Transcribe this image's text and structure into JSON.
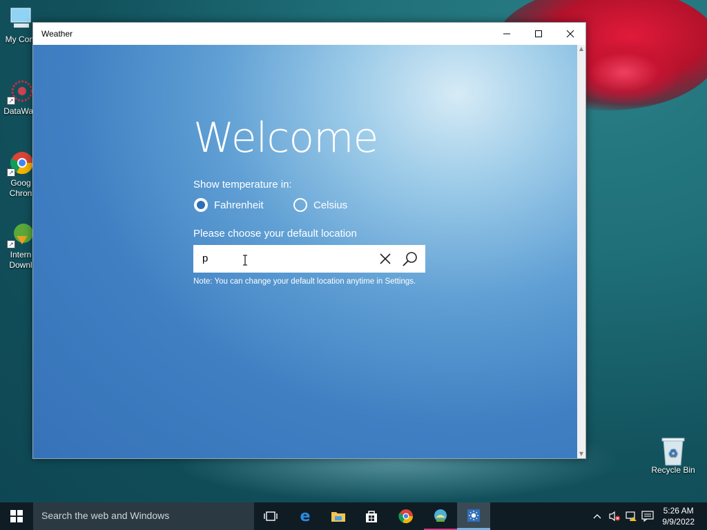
{
  "desktop": {
    "icons": [
      {
        "label": "My Com"
      },
      {
        "label": "DataWag"
      },
      {
        "label": "Goog Chron"
      },
      {
        "label": "Intern Downl"
      },
      {
        "label": "Recycle Bin"
      }
    ]
  },
  "window": {
    "title": "Weather"
  },
  "welcome": {
    "heading": "Welcome",
    "temp_label": "Show temperature in:",
    "options": [
      "Fahrenheit",
      "Celsius"
    ],
    "selected": "Fahrenheit",
    "location_label": "Please choose your default location",
    "location_value": "p",
    "note": "Note: You can change your default location anytime in Settings."
  },
  "taskbar": {
    "search_placeholder": "Search the web and Windows",
    "time": "5:26 AM",
    "date": "9/9/2022"
  },
  "colors": {
    "taskbar_bg": "#101c24",
    "radio_accent": "#2f6fb8",
    "desktop_bg": "#12525d"
  }
}
